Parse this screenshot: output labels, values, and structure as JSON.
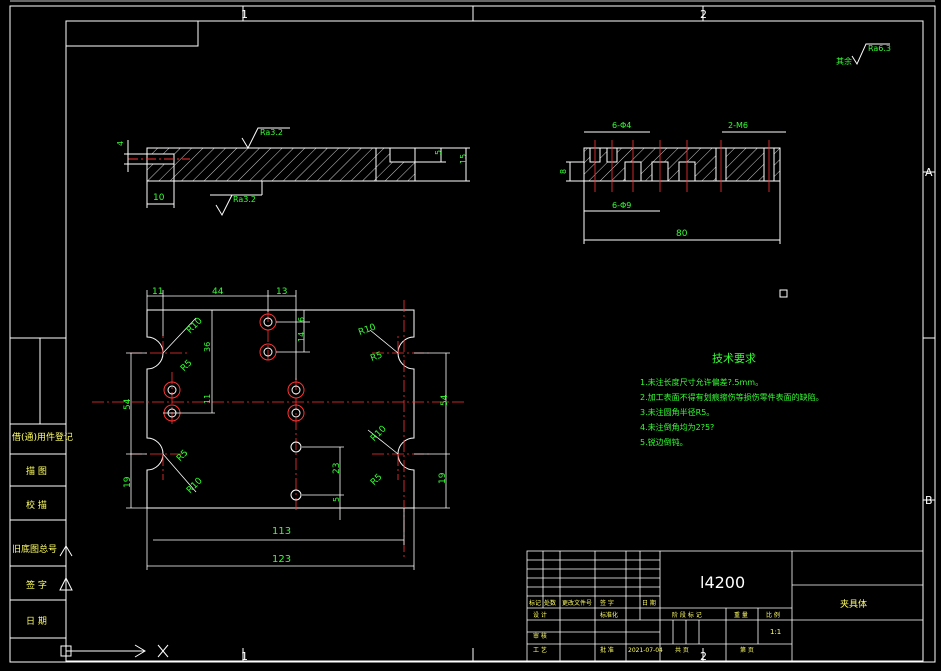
{
  "sheet": {
    "zone_top_1": "1",
    "zone_top_2": "2",
    "zone_bottom_1": "1",
    "zone_bottom_2": "2",
    "zone_right_a": "A",
    "zone_right_b": "B"
  },
  "left_panel": {
    "r1": "借(通)用件登记",
    "r2": "描 图",
    "r3": "校 描",
    "r4": "旧底图总号",
    "r5": "签 字",
    "r6": "日 期"
  },
  "roughness": {
    "overall": "Ra6.3",
    "overall_prefix": "其余",
    "top": "Ra3.2",
    "bottom": "Ra3.2"
  },
  "section_view": {
    "dim_4": "4",
    "dim_10": "10",
    "dim_5": "5",
    "dim_15": "15"
  },
  "side_view": {
    "holes_4": "6-Φ4",
    "holes_9": "6-Φ9",
    "thread": "2-M6",
    "dim_8": "8",
    "dim_80": "80"
  },
  "plan_view": {
    "d11": "11",
    "d44": "44",
    "d13": "13",
    "d6": "6",
    "d14": "14",
    "d36": "36",
    "d11b": "11",
    "d54l": "54",
    "d54r": "54",
    "d19l": "19",
    "d19r": "19",
    "d23": "23",
    "d5": "5",
    "d113": "113",
    "d123": "123",
    "r10a": "R10",
    "r5a": "R5",
    "r10b": "R10",
    "r5b": "R5",
    "r5c": "R5",
    "r10c": "R10",
    "r10d": "R10",
    "r5d": "R5"
  },
  "tech_req": {
    "title": "技术要求",
    "l1": "1.未注长度尺寸允许偏差?.5mm。",
    "l2": "2.加工表面不得有划痕擦伤等损伤零件表面的缺陷。",
    "l3": "3.未注圆角半径R5。",
    "l4": "4.未注倒角均为2?5?",
    "l5": "5.锐边倒钝。"
  },
  "title_block": {
    "material": "l4200",
    "part_name": "夹具体",
    "mark": "标记",
    "count": "处数",
    "change_doc": "更改文件号",
    "sign": "签 字",
    "date": "日 期",
    "design": "设 计",
    "standardize": "标准化",
    "review": "审 核",
    "process": "工 艺",
    "date_value": "2021-07-04",
    "approve": "批 准",
    "stage_mark": "阶 段 标 记",
    "weight": "重 量",
    "scale": "比 例",
    "scale_value": "1:1",
    "total": "共 页",
    "sheet_no": "第 页"
  }
}
